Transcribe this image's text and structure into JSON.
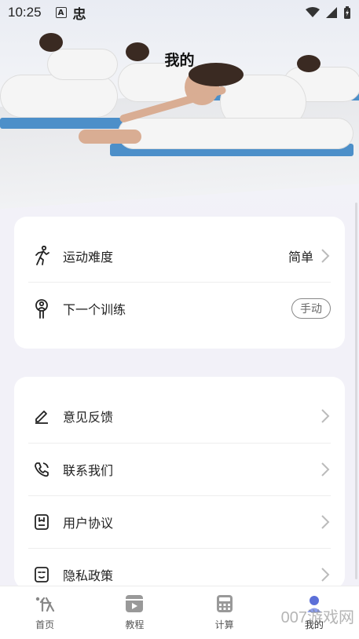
{
  "status_bar": {
    "time": "10:25",
    "app_icon_1": "A",
    "app_icon_2": "忠"
  },
  "page": {
    "title": "我的"
  },
  "settings_card": {
    "items": [
      {
        "icon": "runner-icon",
        "label": "运动难度",
        "value": "简单"
      },
      {
        "icon": "person-icon",
        "label": "下一个训练",
        "value": "手动"
      }
    ]
  },
  "more_card": {
    "items": [
      {
        "icon": "pen-icon",
        "label": "意见反馈"
      },
      {
        "icon": "phone-icon",
        "label": "联系我们"
      },
      {
        "icon": "agreement-icon",
        "label": "用户协议"
      },
      {
        "icon": "privacy-icon",
        "label": "隐私政策"
      }
    ]
  },
  "tabbar": {
    "tabs": [
      {
        "label": "首页",
        "icon": "home-icon"
      },
      {
        "label": "教程",
        "icon": "video-icon"
      },
      {
        "label": "计算",
        "icon": "calculator-icon"
      },
      {
        "label": "我的",
        "icon": "profile-icon",
        "active": true
      }
    ]
  },
  "watermark": "007游戏网"
}
